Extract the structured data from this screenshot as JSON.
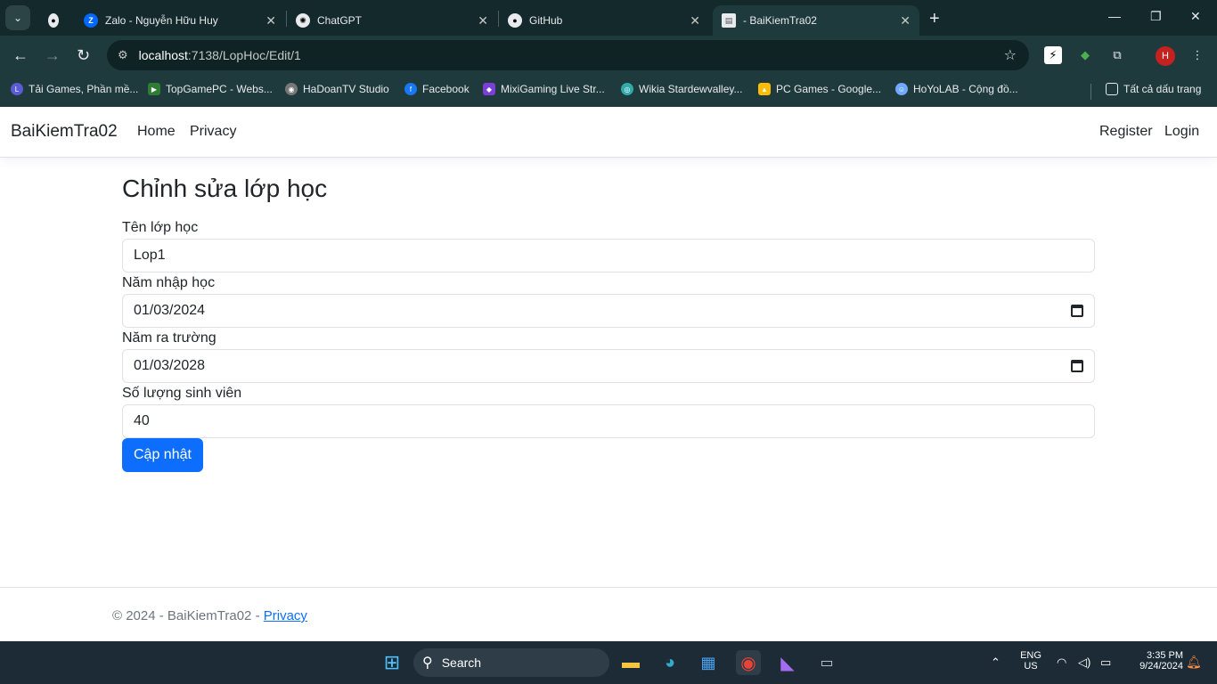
{
  "browser": {
    "tabs": [
      {
        "title": "Zalo - Nguyễn Hữu Huy"
      },
      {
        "title": "ChatGPT"
      },
      {
        "title": "GitHub"
      },
      {
        "title": "- BaiKiemTra02"
      }
    ],
    "url_host": "localhost",
    "url_path": ":7138/LopHoc/Edit/1",
    "bookmarks": [
      "Tải Games, Phần mề...",
      "TopGamePC - Webs...",
      "HaDoanTV Studio",
      "Facebook",
      "MixiGaming Live Str...",
      "Wikia Stardewvalley...",
      "PC Games - Google...",
      "HoYoLAB - Cộng đồ..."
    ],
    "all_bookmarks": "Tất cả dấu trang",
    "profile_initial": "H"
  },
  "app": {
    "brand": "BaiKiemTra02",
    "nav": {
      "home": "Home",
      "privacy": "Privacy",
      "register": "Register",
      "login": "Login"
    },
    "title": "Chỉnh sửa lớp học",
    "fields": {
      "ten_lop_label": "Tên lớp học",
      "ten_lop_value": "Lop1",
      "nam_nhap_label": "Năm nhập học",
      "nam_nhap_value": "01/03/2024",
      "nam_ra_label": "Năm ra trường",
      "nam_ra_value": "01/03/2028",
      "so_luong_label": "Số lượng sinh viên",
      "so_luong_value": "40"
    },
    "submit": "Cập nhật",
    "footer_prefix": "© 2024 - BaiKiemTra02 - ",
    "footer_link": "Privacy"
  },
  "taskbar": {
    "search": "Search",
    "lang_top": "ENG",
    "lang_bottom": "US",
    "time": "3:35 PM",
    "date": "9/24/2024"
  }
}
